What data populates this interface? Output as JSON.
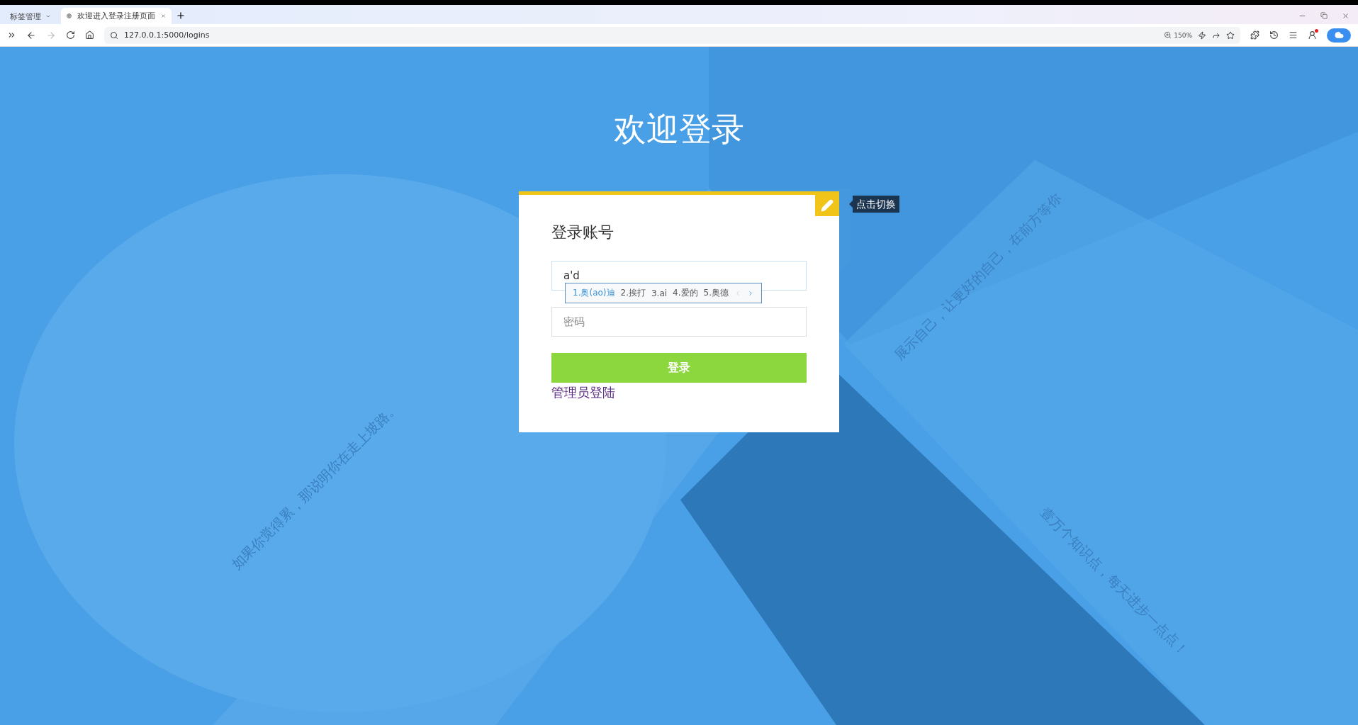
{
  "browser": {
    "tab_group": {
      "label": "标签管理",
      "selected": false
    },
    "tabs": [
      {
        "label": "欢迎进入登录注册页面",
        "selected": true
      }
    ],
    "address": "127.0.0.1:5000/logins",
    "zoom": "150%"
  },
  "page": {
    "heading": "欢迎登录",
    "background_texts": [
      {
        "text": "如果你觉得累，那说明你在走上坡路。",
        "kind": "up"
      },
      {
        "text": "展示自己，让更好的自己，在前方等你",
        "kind": "up"
      },
      {
        "text": "壹万个知识点，每天进步一点点！",
        "kind": "down"
      }
    ],
    "card": {
      "title": "登录账号",
      "switch_tooltip": "点击切换",
      "username": {
        "value": "a'd"
      },
      "ime_candidates": [
        {
          "text": "1.奥(ao)迪",
          "selected": true
        },
        {
          "text": "2.挨打",
          "selected": false
        },
        {
          "text": "3.ai",
          "selected": false
        },
        {
          "text": "4.爱的",
          "selected": false
        },
        {
          "text": "5.奥德",
          "selected": false
        }
      ],
      "password": {
        "placeholder": "密码"
      },
      "submit": "登录",
      "admin_link": "管理员登陆"
    }
  }
}
